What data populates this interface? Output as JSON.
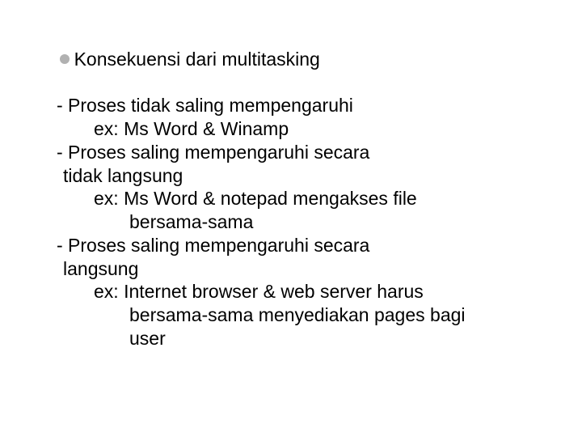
{
  "accent_color": "#b1b1b1",
  "lines": {
    "l0": "Konsekuensi dari multitasking",
    "l1": "- Proses tidak saling mempengaruhi",
    "l2": "ex: Ms Word & Winamp",
    "l3": "- Proses saling mempengaruhi secara",
    "l4": "tidak langsung",
    "l5": "ex: Ms Word & notepad mengakses file",
    "l6": "bersama-sama",
    "l7": "- Proses saling mempengaruhi secara",
    "l8": "langsung",
    "l9": "ex: Internet browser & web server harus",
    "l10": "bersama-sama menyediakan pages bagi",
    "l11": "user"
  }
}
